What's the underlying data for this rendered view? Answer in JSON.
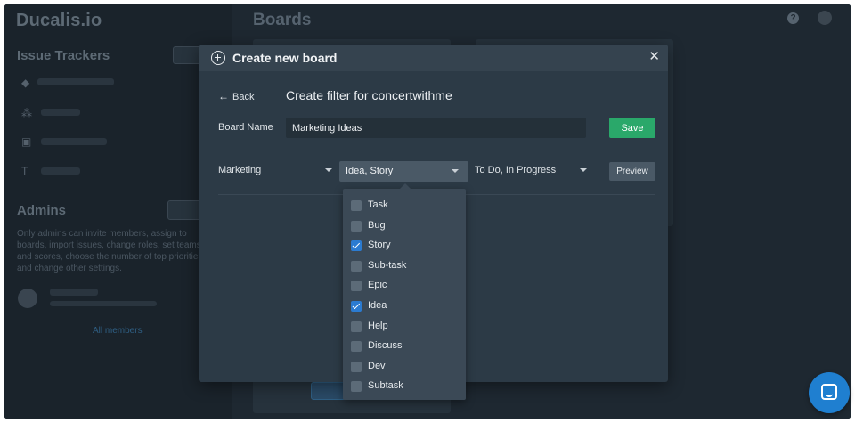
{
  "app": {
    "logo": "Ducalis.io",
    "page_title": "Boards"
  },
  "sidebar": {
    "issue_trackers_heading": "Issue Trackers",
    "admins_heading": "Admins",
    "admins_text": "Only admins can invite members, assign to boards, import issues, change roles, set teams and scores, choose the number of top priorities and change other settings.",
    "all_members_link": "All members"
  },
  "modal": {
    "title": "Create new board",
    "back_label": "Back",
    "filter_title": "Create filter for concertwithme",
    "board_name_label": "Board Name",
    "board_name_value": "Marketing Ideas",
    "save_label": "Save",
    "project_select": "Marketing",
    "issue_type_select": "Idea, Story",
    "status_select": "To Do, In Progress",
    "preview_label": "Preview"
  },
  "issue_type_options": [
    {
      "label": "Task",
      "checked": false
    },
    {
      "label": "Bug",
      "checked": false
    },
    {
      "label": "Story",
      "checked": true
    },
    {
      "label": "Sub-task",
      "checked": false
    },
    {
      "label": "Epic",
      "checked": false
    },
    {
      "label": "Idea",
      "checked": true
    },
    {
      "label": "Help",
      "checked": false
    },
    {
      "label": "Discuss",
      "checked": false
    },
    {
      "label": "Dev",
      "checked": false
    },
    {
      "label": "Subtask",
      "checked": false
    }
  ],
  "colors": {
    "save_button": "#2aa86a",
    "checkbox_checked": "#2b7bd1",
    "chat_launcher": "#1f7fd0"
  }
}
